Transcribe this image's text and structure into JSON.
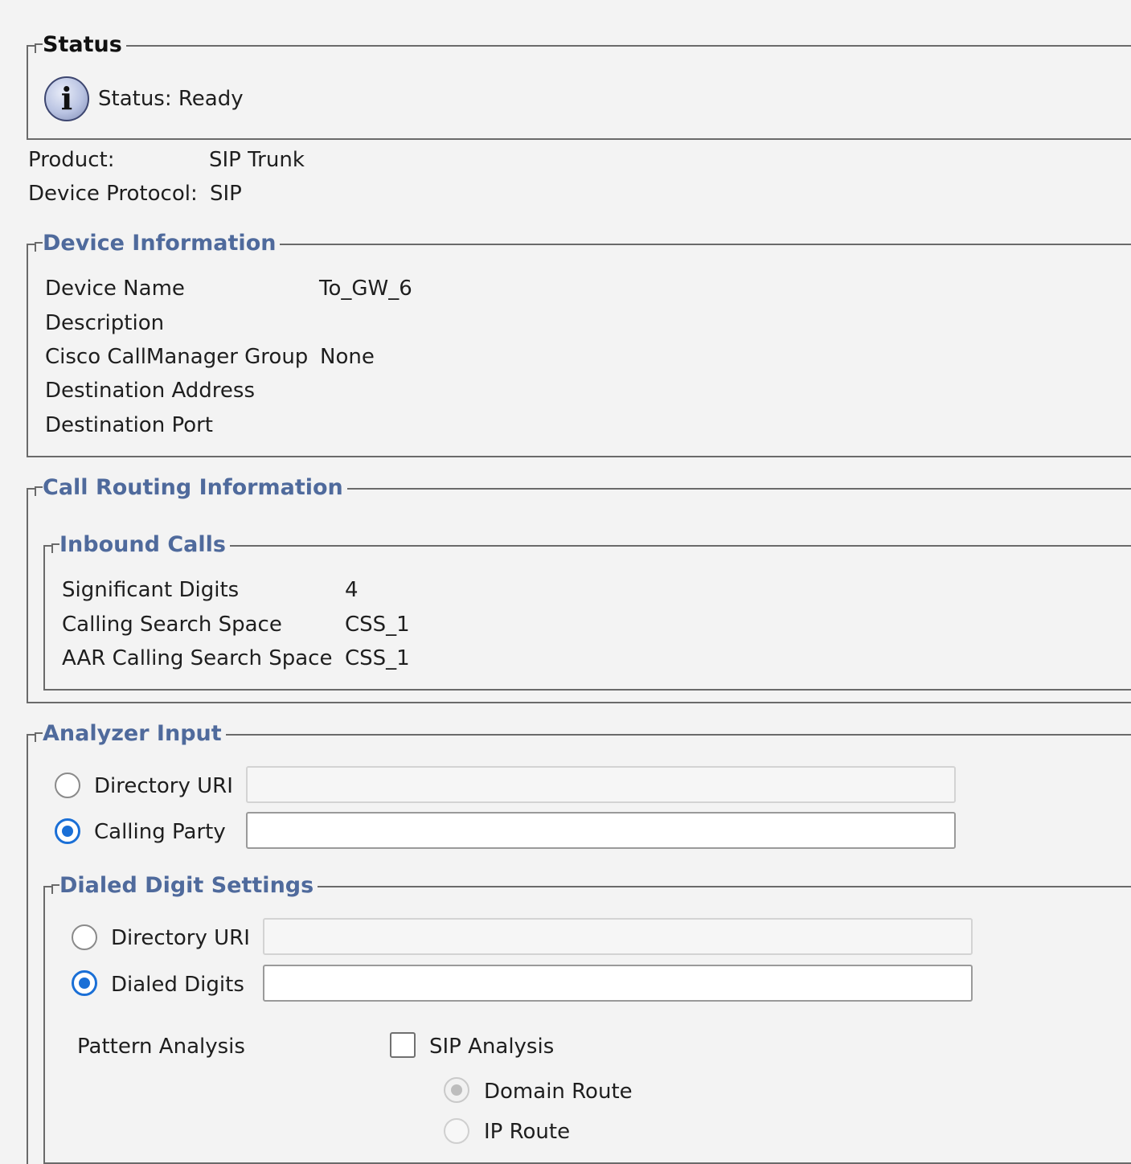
{
  "status": {
    "legend": "Status",
    "icon": "info-icon",
    "message": "Status: Ready"
  },
  "product": {
    "label": "Product:",
    "value": "SIP Trunk",
    "protocol_label": "Device Protocol:",
    "protocol_value": "SIP"
  },
  "device_information": {
    "legend": "Device Information",
    "rows": [
      {
        "label": "Device Name",
        "value": "To_GW_6"
      },
      {
        "label": "Description",
        "value": ""
      },
      {
        "label": "Cisco CallManager Group",
        "value": "None"
      },
      {
        "label": "Destination Address",
        "value": ""
      },
      {
        "label": "Destination Port",
        "value": ""
      }
    ]
  },
  "call_routing": {
    "legend": "Call Routing Information",
    "inbound": {
      "legend": "Inbound Calls",
      "rows": [
        {
          "label": "Significant Digits",
          "value": "4"
        },
        {
          "label": "Calling Search Space",
          "value": "CSS_1"
        },
        {
          "label": "AAR Calling Search Space",
          "value": "CSS_1"
        }
      ]
    }
  },
  "analyzer_input": {
    "legend": "Analyzer Input",
    "options": [
      {
        "label": "Directory URI",
        "selected": false,
        "value": ""
      },
      {
        "label": "Calling Party",
        "selected": true,
        "value": ""
      }
    ],
    "dialed_digit_settings": {
      "legend": "Dialed Digit Settings",
      "options": [
        {
          "label": "Directory URI",
          "selected": false,
          "value": ""
        },
        {
          "label": "Dialed Digits",
          "selected": true,
          "value": ""
        }
      ],
      "pattern_analysis_label": "Pattern Analysis",
      "sip_analysis": {
        "label": "SIP Analysis",
        "checked": false
      },
      "route_options": [
        {
          "label": "Domain Route",
          "selected": true,
          "enabled": false
        },
        {
          "label": "IP Route",
          "selected": false,
          "enabled": false
        }
      ]
    }
  },
  "colors": {
    "legend_blue": "#4f6a9c",
    "radio_selected": "#1a6fd6",
    "border": "#6a6a6a",
    "background": "#f3f3f3"
  }
}
